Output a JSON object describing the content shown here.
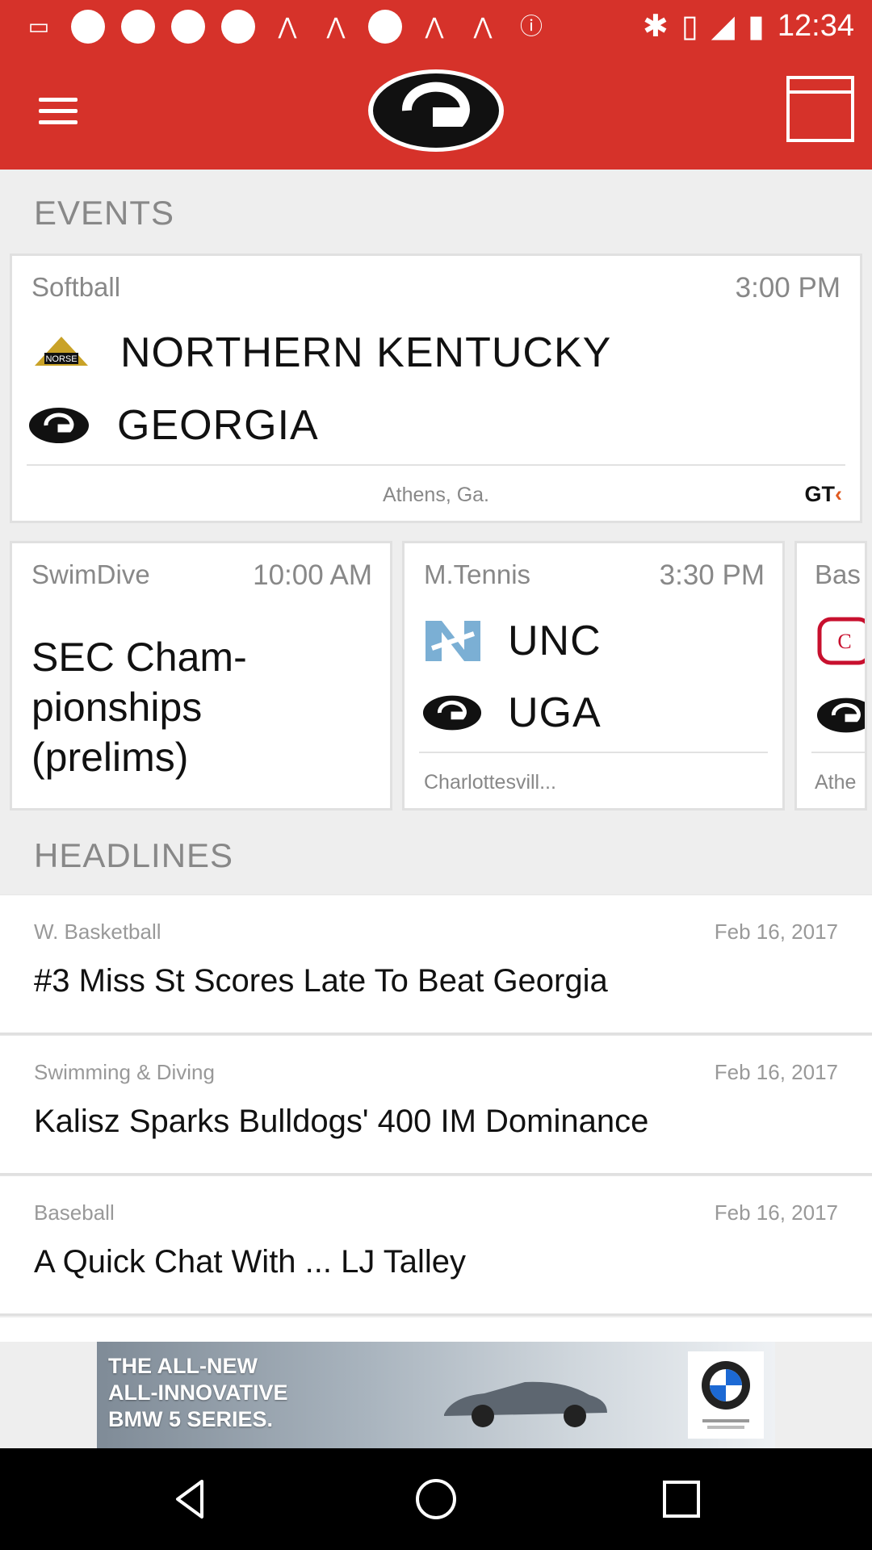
{
  "status_bar": {
    "time": "12:34"
  },
  "header": {
    "logo_letter": "G",
    "menu_icon": "hamburger-icon",
    "calendar_icon": "calendar-icon"
  },
  "events": {
    "title": "EVENTS",
    "featured": {
      "sport": "Softball",
      "time": "3:00 PM",
      "away_team": "NORTHERN KENTUCKY",
      "home_team": "GEORGIA",
      "location": "Athens, Ga.",
      "broadcaster": "GT"
    },
    "cards": [
      {
        "sport": "SwimDive",
        "time": "10:00 AM",
        "title": "SEC Cham-\npionships\n(prelims)"
      },
      {
        "sport": "M.Tennis",
        "time": "3:30 PM",
        "away_team": "UNC",
        "home_team": "UGA",
        "location": "Charlottesvill..."
      },
      {
        "sport": "Bas",
        "location": "Athe"
      }
    ]
  },
  "headlines": {
    "title": "HEADLINES",
    "items": [
      {
        "category": "W. Basketball",
        "date": "Feb 16, 2017",
        "title": "#3 Miss St Scores Late To Beat Georgia"
      },
      {
        "category": "Swimming & Diving",
        "date": "Feb 16, 2017",
        "title": "Kalisz Sparks Bulldogs' 400 IM Dominance"
      },
      {
        "category": "Baseball",
        "date": "Feb 16, 2017",
        "title": "A Quick Chat With ... LJ Talley"
      }
    ]
  },
  "ad": {
    "text": "THE ALL-NEW\nALL-INNOVATIVE\nBMW 5 SERIES."
  },
  "colors": {
    "brand_red": "#d6322a",
    "unc_blue": "#7bafd4",
    "gt_orange": "#e05a20"
  }
}
